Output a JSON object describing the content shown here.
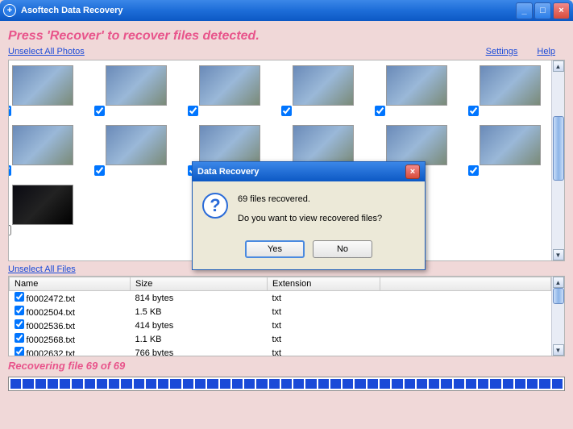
{
  "titlebar": {
    "app_title": "Asoftech Data Recovery"
  },
  "instruction": "Press 'Recover' to recover files detected.",
  "links": {
    "unselect_photos": "Unselect All Photos",
    "unselect_files": "Unselect All Files",
    "settings": "Settings",
    "help": "Help"
  },
  "photos": [
    {
      "checked": true
    },
    {
      "checked": true
    },
    {
      "checked": true
    },
    {
      "checked": true
    },
    {
      "checked": true
    },
    {
      "checked": true
    },
    {
      "checked": true
    },
    {
      "checked": true
    },
    {
      "checked": true
    },
    {
      "checked": true
    },
    {
      "checked": true
    },
    {
      "checked": true
    },
    {
      "checked": false,
      "dark": true
    }
  ],
  "files": {
    "columns": {
      "name": "Name",
      "size": "Size",
      "ext": "Extension"
    },
    "rows": [
      {
        "checked": true,
        "name": "f0002472.txt",
        "size": "814 bytes",
        "ext": "txt"
      },
      {
        "checked": true,
        "name": "f0002504.txt",
        "size": "1.5 KB",
        "ext": "txt"
      },
      {
        "checked": true,
        "name": "f0002536.txt",
        "size": "414 bytes",
        "ext": "txt"
      },
      {
        "checked": true,
        "name": "f0002568.txt",
        "size": "1.1 KB",
        "ext": "txt"
      },
      {
        "checked": true,
        "name": "f0002632.txt",
        "size": "766 bytes",
        "ext": "txt"
      }
    ]
  },
  "status": "Recovering file 69 of 69",
  "progress": {
    "segments": 45,
    "filled": 45
  },
  "dialog": {
    "title": "Data Recovery",
    "line1": "69 files recovered.",
    "line2": "Do you want to view recovered files?",
    "yes": "Yes",
    "no": "No"
  }
}
